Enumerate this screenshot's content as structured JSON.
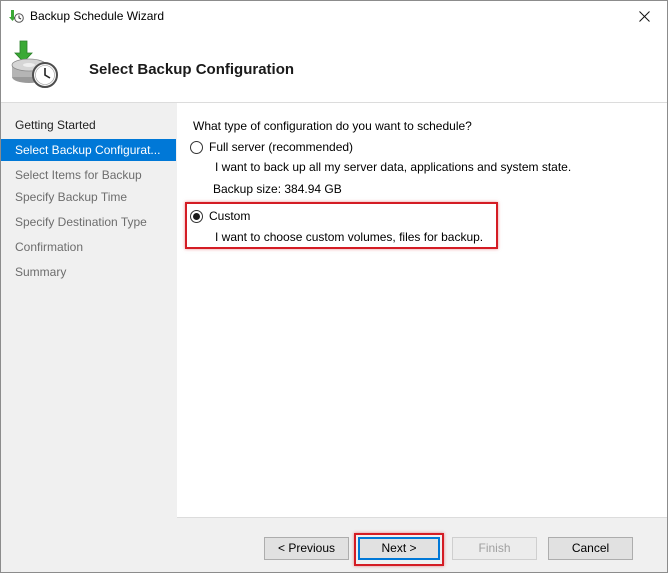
{
  "window": {
    "title": "Backup Schedule Wizard",
    "icons": {
      "app": "backup-schedule-icon",
      "close": "close-icon",
      "header": "backup-disk-clock-icon"
    }
  },
  "header": {
    "title": "Select Backup Configuration"
  },
  "nav": {
    "items": [
      {
        "label": "Getting Started",
        "state": "done"
      },
      {
        "label": "Select Backup Configurat...",
        "state": "active"
      },
      {
        "label": "Select Items for Backup",
        "state": "pending"
      },
      {
        "label": "Specify Backup Time",
        "state": "pending"
      },
      {
        "label": "Specify Destination Type",
        "state": "pending"
      },
      {
        "label": "Confirmation",
        "state": "pending"
      },
      {
        "label": "Summary",
        "state": "pending"
      }
    ]
  },
  "content": {
    "question": "What type of configuration do you want to schedule?",
    "options": [
      {
        "label": "Full server (recommended)",
        "description": "I want to back up all my server data, applications and system state.",
        "extra": "Backup size: 384.94 GB",
        "selected": false
      },
      {
        "label": "Custom",
        "description": "I want to choose custom volumes, files for backup.",
        "selected": true
      }
    ]
  },
  "footer": {
    "previous": "< Previous",
    "next": "Next >",
    "finish": "Finish",
    "cancel": "Cancel"
  },
  "colors": {
    "accent": "#0078d7",
    "highlight": "#d41c24"
  }
}
